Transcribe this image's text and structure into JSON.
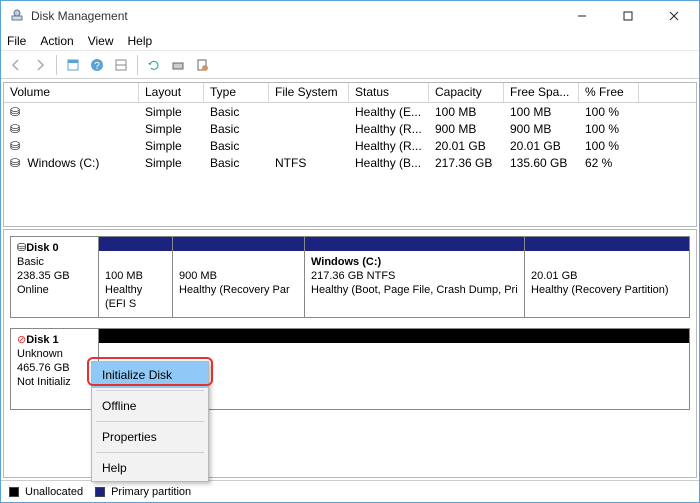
{
  "window": {
    "title": "Disk Management"
  },
  "menubar": [
    "File",
    "Action",
    "View",
    "Help"
  ],
  "columns": {
    "volume": "Volume",
    "layout": "Layout",
    "type": "Type",
    "fs": "File System",
    "status": "Status",
    "capacity": "Capacity",
    "free": "Free Spa...",
    "pct": "% Free"
  },
  "rows": [
    {
      "volume": "",
      "layout": "Simple",
      "type": "Basic",
      "fs": "",
      "status": "Healthy (E...",
      "capacity": "100 MB",
      "free": "100 MB",
      "pct": "100 %"
    },
    {
      "volume": "",
      "layout": "Simple",
      "type": "Basic",
      "fs": "",
      "status": "Healthy (R...",
      "capacity": "900 MB",
      "free": "900 MB",
      "pct": "100 %"
    },
    {
      "volume": "",
      "layout": "Simple",
      "type": "Basic",
      "fs": "",
      "status": "Healthy (R...",
      "capacity": "20.01 GB",
      "free": "20.01 GB",
      "pct": "100 %"
    },
    {
      "volume": "Windows (C:)",
      "layout": "Simple",
      "type": "Basic",
      "fs": "NTFS",
      "status": "Healthy (B...",
      "capacity": "217.36 GB",
      "free": "135.60 GB",
      "pct": "62 %"
    }
  ],
  "disk0": {
    "name": "Disk 0",
    "type": "Basic",
    "size": "238.35 GB",
    "state": "Online",
    "parts": [
      {
        "l1": "100 MB",
        "l2": "Healthy (EFI S"
      },
      {
        "l1": "900 MB",
        "l2": "Healthy (Recovery Par"
      },
      {
        "t": "Windows  (C:)",
        "l1": "217.36 GB NTFS",
        "l2": "Healthy (Boot, Page File, Crash Dump, Pri"
      },
      {
        "l1": "20.01 GB",
        "l2": "Healthy (Recovery Partition)"
      }
    ]
  },
  "disk1": {
    "name": "Disk 1",
    "type": "Unknown",
    "size": "465.76 GB",
    "state": "Not Initializ"
  },
  "ctx": {
    "initialize": "Initialize Disk",
    "offline": "Offline",
    "properties": "Properties",
    "help": "Help"
  },
  "legend": {
    "unalloc": "Unallocated",
    "primary": "Primary partition"
  }
}
